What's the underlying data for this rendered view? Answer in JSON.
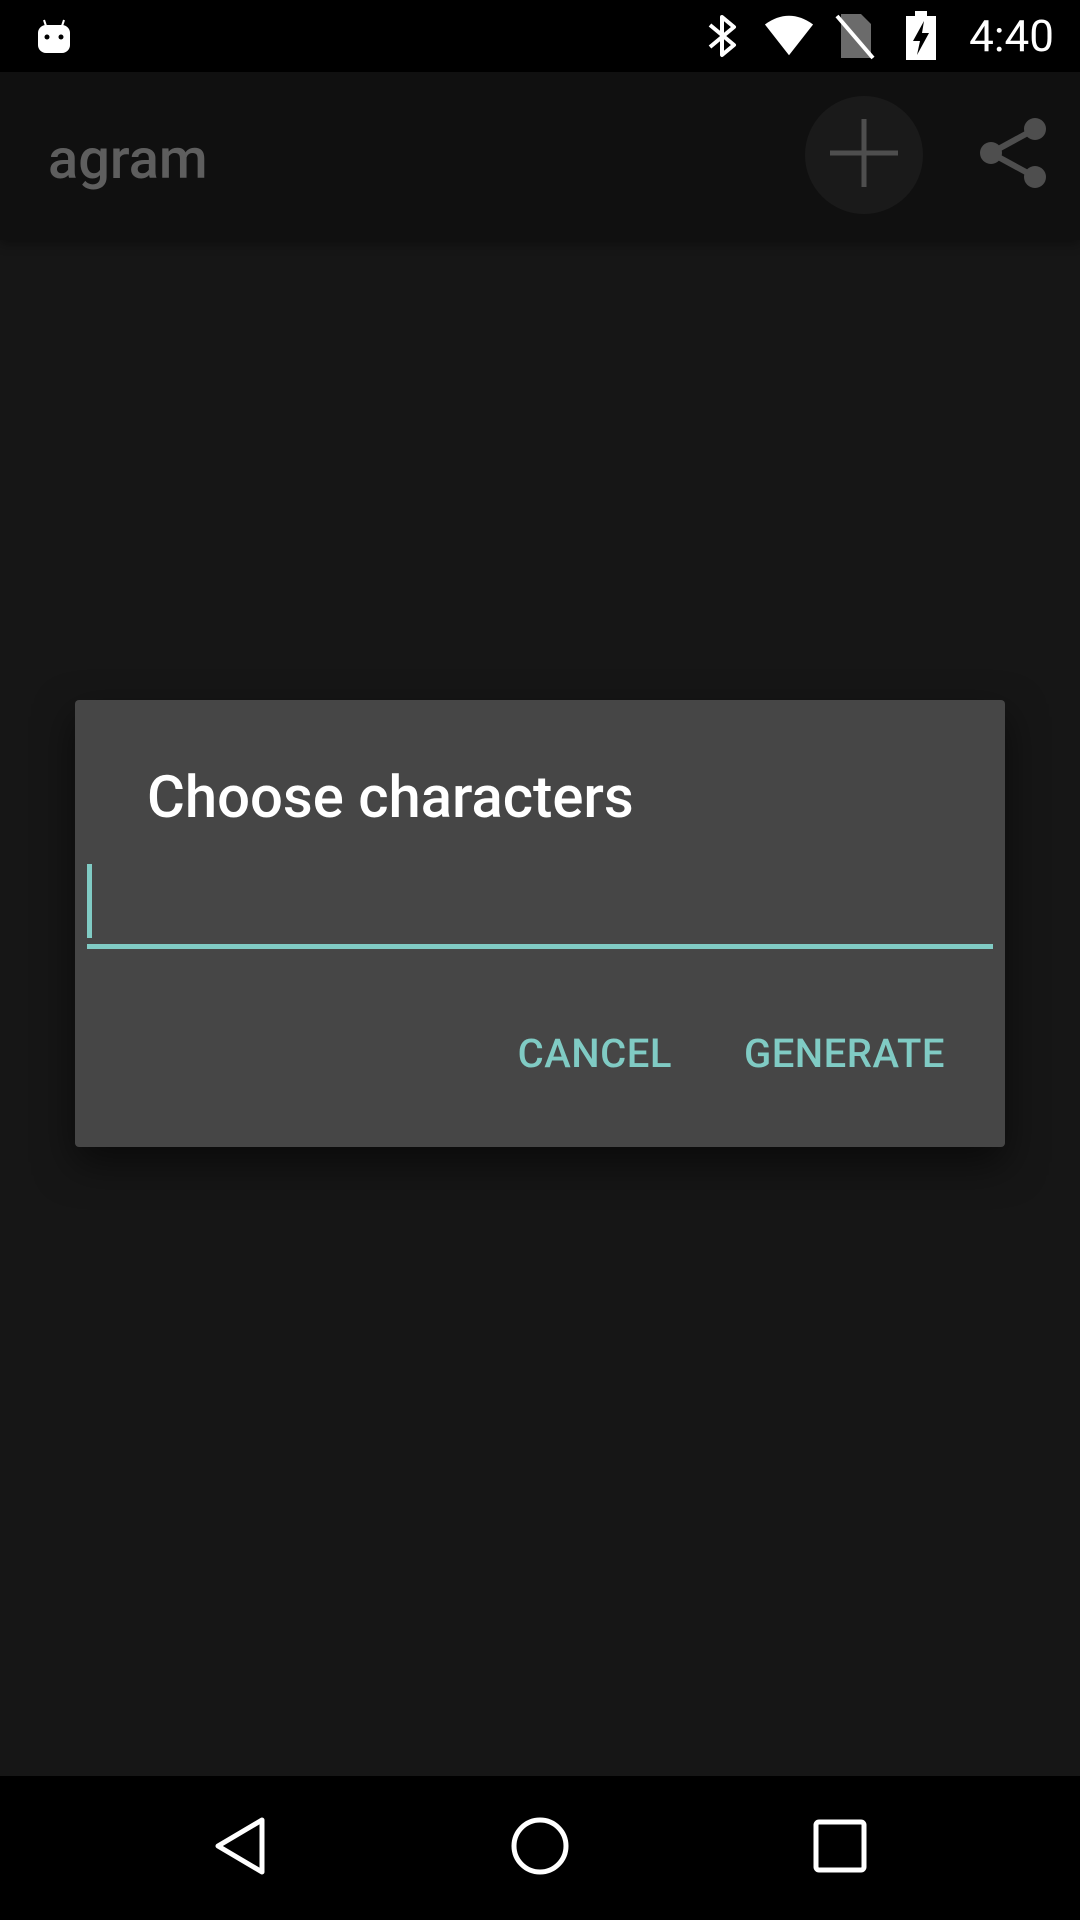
{
  "status_bar": {
    "time": "4:40",
    "left_icon": "android-notification-icon",
    "icons": [
      "bluetooth-icon",
      "wifi-icon",
      "no-sim-icon",
      "battery-charging-icon"
    ]
  },
  "app_bar": {
    "title": "agram",
    "actions": [
      {
        "icon": "add-icon"
      },
      {
        "icon": "share-icon"
      }
    ]
  },
  "dialog": {
    "title": "Choose characters",
    "input_value": "",
    "cancel_label": "CANCEL",
    "generate_label": "GENERATE"
  },
  "nav_bar": {
    "icons": [
      "back-icon",
      "home-icon",
      "recents-icon"
    ]
  },
  "colors": {
    "accent": "#80cbc4",
    "dialog_bg": "#464646",
    "background": "#161616"
  }
}
